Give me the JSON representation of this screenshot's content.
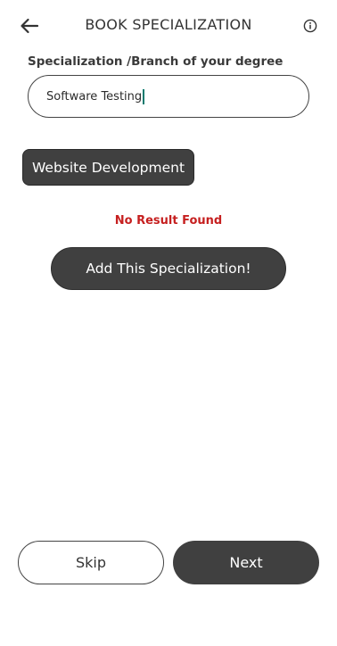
{
  "header": {
    "title": "BOOK SPECIALIZATION",
    "back_icon": "arrow-left-icon",
    "info_icon": "info-circle-icon"
  },
  "form": {
    "label": "Specialization /Branch of your degree",
    "search_value": "Software Testing"
  },
  "suggestions": [
    {
      "label": "Website Development"
    }
  ],
  "status": {
    "no_result": "No Result Found",
    "color": "#c62020"
  },
  "actions": {
    "add_label": "Add This Specialization!",
    "skip_label": "Skip",
    "next_label": "Next"
  },
  "colors": {
    "dark_button": "#404040",
    "caret": "#0b7a6e"
  }
}
